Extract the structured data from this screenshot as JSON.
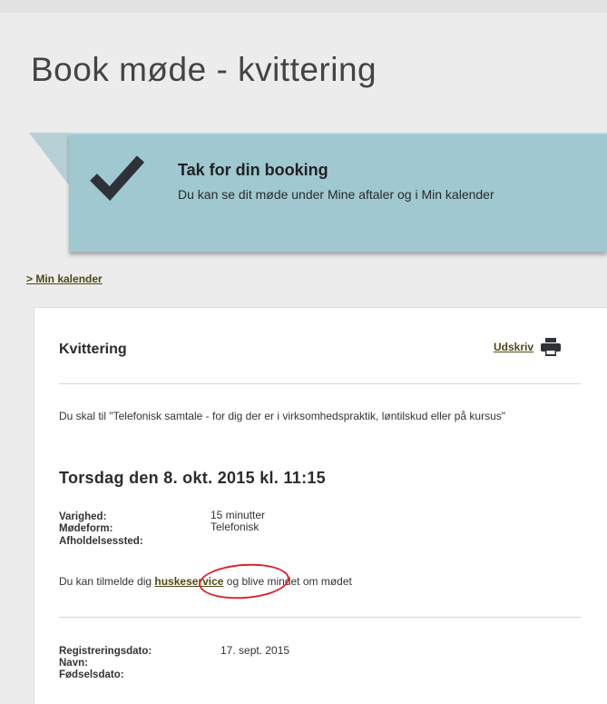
{
  "page": {
    "title": "Book møde - kvittering"
  },
  "banner": {
    "icon": "checkmark-icon",
    "title": "Tak for din booking",
    "text": "Du kan se dit møde under Mine aftaler og i Min kalender",
    "background": "#9fc8d1"
  },
  "nav": {
    "calendar_link": "> Min kalender"
  },
  "receipt": {
    "title": "Kvittering",
    "print_label": "Udskriv",
    "print_icon": "printer-icon",
    "intro": "Du skal til \"Telefonisk samtale - for dig der er i virksomhedspraktik, løntilskud eller på kursus\"",
    "date_heading": "Torsdag den 8. okt. 2015 kl. 11:15",
    "details": {
      "duration_label": "Varighed:",
      "duration_value": "15 minutter",
      "format_label": "Mødeform:",
      "format_value": "Telefonisk",
      "location_label": "Afholdelsessted:",
      "location_value": ""
    },
    "reminder": {
      "before": "Du kan tilmelde dig ",
      "link": "huskeservice",
      "after": " og blive mindet om mødet"
    },
    "registration": {
      "date_label": "Registreringsdato:",
      "date_value": "17. sept. 2015",
      "name_label": "Navn:",
      "name_value": "",
      "birth_label": "Fødselsdato:",
      "birth_value": ""
    }
  },
  "colors": {
    "link": "#4b4a14",
    "annotation": "#d9262b"
  }
}
